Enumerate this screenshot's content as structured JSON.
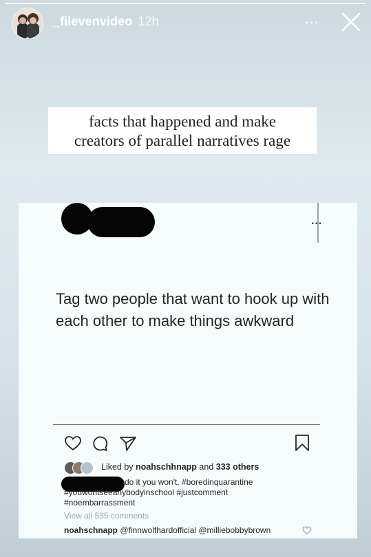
{
  "story": {
    "progress": 1.0,
    "username": "_filevenvideo",
    "time": "12h",
    "more_label": "...",
    "caption_line1": "facts that happened and make",
    "caption_line2": "creators of parallel narratives rage"
  },
  "post": {
    "more_label": "...",
    "text": "Tag two people that want to hook up with each other to make things awkward",
    "liked_by_prefix": "Liked by ",
    "liked_by_user": "noahschhnapp",
    "liked_by_mid": " and ",
    "liked_by_count": "333 others",
    "comment_line1": "do it you won't. #boredinquarantine",
    "comment_line2": "#youwontseeanybodyinschool #justcomment",
    "comment_line3": "#noembarrassment",
    "view_all": "View all 535 comments",
    "reply_user": "noahschnapp",
    "reply_text": " @finnwolfhardofficial @milliebobbybrown"
  },
  "colors": {
    "redaction": "#050505",
    "card_background": "#f6fbfc"
  },
  "icons": {
    "close": "close-icon",
    "heart": "heart-icon",
    "comment": "comment-icon",
    "share": "send-icon",
    "save": "bookmark-icon"
  }
}
